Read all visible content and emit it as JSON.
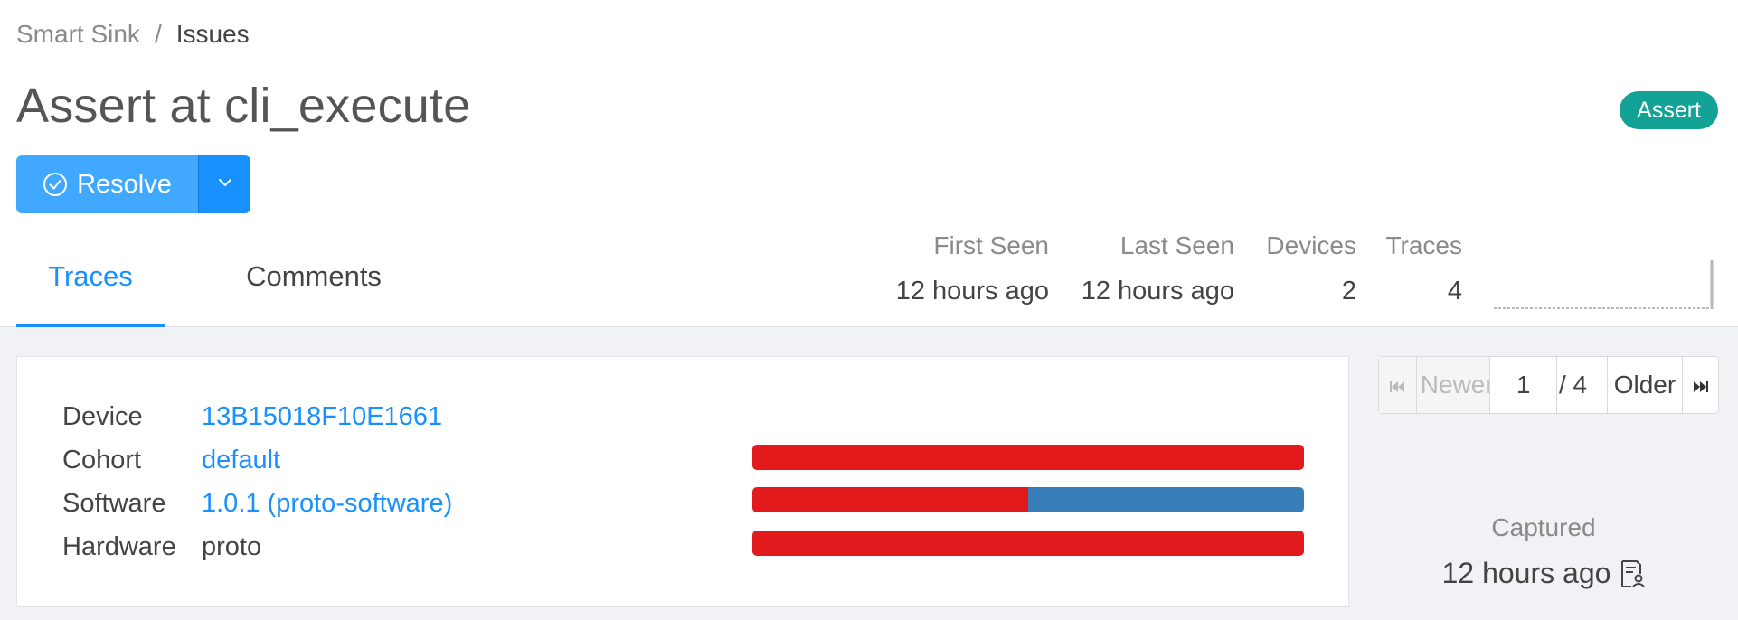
{
  "breadcrumb": {
    "parent": "Smart Sink",
    "separator": "/",
    "current": "Issues"
  },
  "title": "Assert at cli_execute",
  "tag": {
    "label": "Assert",
    "color": "#13a396"
  },
  "actions": {
    "resolve_label": "Resolve"
  },
  "tabs": [
    {
      "label": "Traces",
      "active": true
    },
    {
      "label": "Comments",
      "active": false
    }
  ],
  "stats": {
    "first_seen": {
      "label": "First Seen",
      "value": "12 hours ago"
    },
    "last_seen": {
      "label": "Last Seen",
      "value": "12 hours ago"
    },
    "devices": {
      "label": "Devices",
      "value": "2"
    },
    "traces": {
      "label": "Traces",
      "value": "4"
    }
  },
  "trace": {
    "device": {
      "label": "Device",
      "value": "13B15018F10E1661"
    },
    "cohort": {
      "label": "Cohort",
      "value": "default"
    },
    "software": {
      "label": "Software",
      "value": "1.0.1 (proto-software)"
    },
    "hardware": {
      "label": "Hardware",
      "value": "proto"
    }
  },
  "distribution_bars": [
    {
      "segments": [
        {
          "fraction": 1.0,
          "color": "#e31a1c"
        }
      ]
    },
    {
      "segments": [
        {
          "fraction": 0.5,
          "color": "#e31a1c"
        },
        {
          "fraction": 0.5,
          "color": "#377eb8"
        }
      ]
    },
    {
      "segments": [
        {
          "fraction": 1.0,
          "color": "#e31a1c"
        }
      ]
    }
  ],
  "pagination": {
    "newer_label": "Newer",
    "current_page": "1",
    "total": "/ 4",
    "older_label": "Older"
  },
  "captured": {
    "label": "Captured",
    "value": "12 hours ago"
  },
  "colors": {
    "accent": "#1890ff",
    "accent_light": "#40a9ff",
    "background": "#f0f2f5"
  }
}
